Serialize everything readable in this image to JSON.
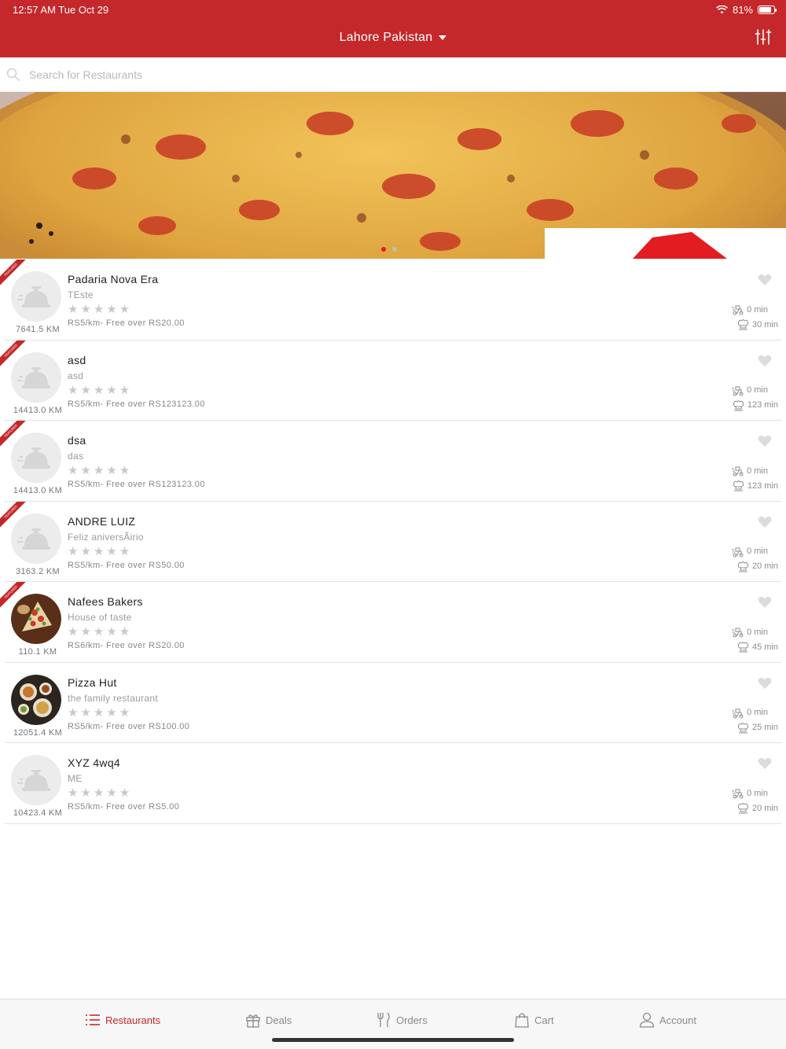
{
  "status_bar": {
    "time": "12:57 AM   Tue Oct 29",
    "battery": "81%",
    "battery_level": 0.81
  },
  "header": {
    "location": "Lahore Pakistan"
  },
  "search": {
    "placeholder": "Search for Restaurants"
  },
  "carousel": {
    "page_count": 2,
    "active_index": 0
  },
  "colors": {
    "brand": "#c4282b",
    "star_empty": "#c9c9c9"
  },
  "restaurants": [
    {
      "name": "Padaria Nova Era",
      "tagline": "TEste",
      "distance": "7641.5 KM",
      "delivery": "RS5/km- Free over RS20.00",
      "time_min": "0 min",
      "time_max": "30 min",
      "featured": true,
      "rating": 0,
      "avatar": "placeholder"
    },
    {
      "name": "asd",
      "tagline": "asd",
      "distance": "14413.0 KM",
      "delivery": "RS5/km- Free over RS123123.00",
      "time_min": "0 min",
      "time_max": "123 min",
      "featured": true,
      "rating": 0,
      "avatar": "placeholder"
    },
    {
      "name": "dsa",
      "tagline": "das",
      "distance": "14413.0 KM",
      "delivery": "RS5/km- Free over RS123123.00",
      "time_min": "0 min",
      "time_max": "123 min",
      "featured": true,
      "rating": 0,
      "avatar": "placeholder"
    },
    {
      "name": "ANDRE LUIZ",
      "tagline": "Feliz aniversÃirio",
      "distance": "3163.2 KM",
      "delivery": "RS5/km- Free over RS50.00",
      "time_min": "0 min",
      "time_max": "20 min",
      "featured": true,
      "rating": 0,
      "avatar": "placeholder"
    },
    {
      "name": "Nafees Bakers",
      "tagline": "House of taste",
      "distance": "110.1 KM",
      "delivery": "RS6/km- Free over RS20.00",
      "time_min": "0 min",
      "time_max": "45 min",
      "featured": true,
      "rating": 0,
      "avatar": "food-photo"
    },
    {
      "name": "Pizza Hut",
      "tagline": "the family restaurant",
      "distance": "12051.4 KM",
      "delivery": "RS5/km- Free over RS100.00",
      "time_min": "0 min",
      "time_max": "25 min",
      "featured": false,
      "rating": 0,
      "avatar": "dishes-photo"
    },
    {
      "name": "XYZ 4wq4",
      "tagline": "ME",
      "distance": "10423.4 KM",
      "delivery": "RS5/km- Free over RS5.00",
      "time_min": "0 min",
      "time_max": "20 min",
      "featured": false,
      "rating": 0,
      "avatar": "placeholder"
    }
  ],
  "tabs": [
    {
      "label": "Restaurants",
      "icon": "list-icon",
      "active": true
    },
    {
      "label": "Deals",
      "icon": "gift-icon",
      "active": false
    },
    {
      "label": "Orders",
      "icon": "fork-knife-icon",
      "active": false
    },
    {
      "label": "Cart",
      "icon": "bag-icon",
      "active": false
    },
    {
      "label": "Account",
      "icon": "person-icon",
      "active": false
    }
  ],
  "stars_glyph": "★★★★★",
  "featured_ribbon_text": "FEATURED"
}
